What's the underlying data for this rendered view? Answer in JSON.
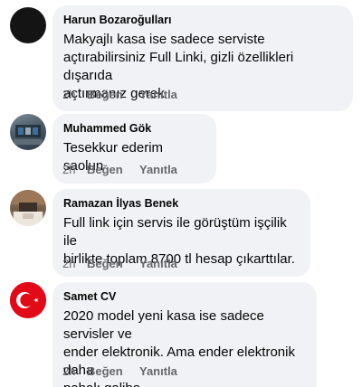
{
  "comments": [
    {
      "author": "Harun Bozaroğulları",
      "text_lines": [
        "Makyajlı kasa ise sadece serviste",
        "açtırabilirsiniz Full Linki, gizli özellikleri dışarıda",
        "açtırmanız gerek"
      ],
      "time": "2h",
      "like_label": "Beğen",
      "reply_label": "Yanıtla",
      "avatar": "black-circle"
    },
    {
      "author": "Muhammed Gök",
      "text_lines": [
        "Tesekkur ederim saolun"
      ],
      "time": "2h",
      "like_label": "Beğen",
      "reply_label": "Yanıtla",
      "avatar": "machine-photo"
    },
    {
      "author": "Ramazan İlyas Benek",
      "text_lines": [
        "Full link için servis ile görüştüm işçilik ile",
        "birlikte toplam 8700 tl hesap çıkarttılar."
      ],
      "time": "2h",
      "like_label": "Beğen",
      "reply_label": "Yanıtla",
      "avatar": "room-photo"
    },
    {
      "author": "Samet CV",
      "text_lines": [
        "2020 model yeni kasa ise sadece servisler ve",
        "ender elektronik. Ama ender elektronik daha",
        "pahalı galiba."
      ],
      "time": "2h",
      "like_label": "Beğen",
      "reply_label": "Yanıtla",
      "avatar": "turkish-flag"
    }
  ]
}
